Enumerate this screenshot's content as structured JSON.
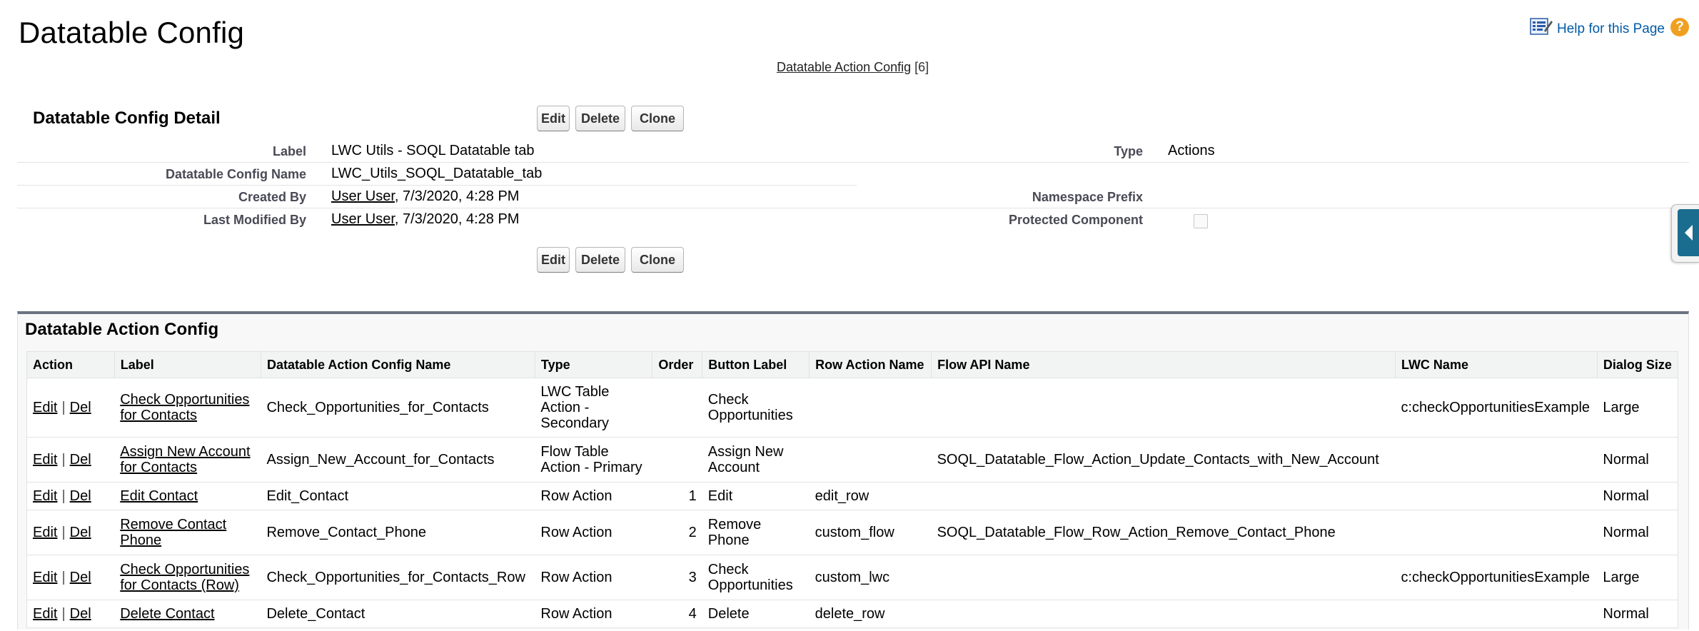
{
  "page": {
    "title": "Datatable Config",
    "help_link": "Help for this Page",
    "related_links": {
      "label": "Datatable Action Config",
      "count": "[6]"
    }
  },
  "detail": {
    "header": "Datatable Config Detail",
    "buttons": {
      "edit": "Edit",
      "delete": "Delete",
      "clone": "Clone"
    },
    "fields": {
      "label": {
        "label": "Label",
        "value": "LWC Utils - SOQL Datatable tab"
      },
      "config_name": {
        "label": "Datatable Config Name",
        "value": "LWC_Utils_SOQL_Datatable_tab"
      },
      "created_by": {
        "label": "Created By",
        "user": "User User",
        "date": ", 7/3/2020, 4:28 PM"
      },
      "last_modified_by": {
        "label": "Last Modified By",
        "user": "User User",
        "date": ", 7/3/2020, 4:28 PM"
      },
      "type": {
        "label": "Type",
        "value": "Actions"
      },
      "namespace_prefix": {
        "label": "Namespace Prefix",
        "value": ""
      },
      "protected_component": {
        "label": "Protected Component",
        "checked": false
      }
    }
  },
  "related_list": {
    "title": "Datatable Action Config",
    "columns": [
      "Action",
      "Label",
      "Datatable Action Config Name",
      "Type",
      "Order",
      "Button Label",
      "Row Action Name",
      "Flow API Name",
      "LWC Name",
      "Dialog Size"
    ],
    "action_edit": "Edit",
    "action_del": "Del",
    "action_sep": "|",
    "rows": [
      {
        "label": "Check Opportunities for Contacts",
        "name": "Check_Opportunities_for_Contacts",
        "type": "LWC Table Action - Secondary",
        "order": "",
        "button_label": "Check Opportunities",
        "row_action": "",
        "flow_api": "",
        "lwc": "c:checkOpportunitiesExample",
        "dialog": "Large"
      },
      {
        "label": "Assign New Account for Contacts",
        "name": "Assign_New_Account_for_Contacts",
        "type": "Flow Table Action - Primary",
        "order": "",
        "button_label": "Assign New Account",
        "row_action": "",
        "flow_api": "SOQL_Datatable_Flow_Action_Update_Contacts_with_New_Account",
        "lwc": "",
        "dialog": "Normal"
      },
      {
        "label": "Edit Contact",
        "name": "Edit_Contact",
        "type": "Row Action",
        "order": "1",
        "button_label": "Edit",
        "row_action": "edit_row",
        "flow_api": "",
        "lwc": "",
        "dialog": "Normal"
      },
      {
        "label": "Remove Contact Phone",
        "name": "Remove_Contact_Phone",
        "type": "Row Action",
        "order": "2",
        "button_label": "Remove Phone",
        "row_action": "custom_flow",
        "flow_api": "SOQL_Datatable_Flow_Row_Action_Remove_Contact_Phone",
        "lwc": "",
        "dialog": "Normal"
      },
      {
        "label": "Check Opportunities for Contacts (Row)",
        "name": "Check_Opportunities_for_Contacts_Row",
        "type": "Row Action",
        "order": "3",
        "button_label": "Check Opportunities",
        "row_action": "custom_lwc",
        "flow_api": "",
        "lwc": "c:checkOpportunitiesExample",
        "dialog": "Large"
      },
      {
        "label": "Delete Contact",
        "name": "Delete_Contact",
        "type": "Row Action",
        "order": "4",
        "button_label": "Delete",
        "row_action": "delete_row",
        "flow_api": "",
        "lwc": "",
        "dialog": "Normal"
      }
    ]
  },
  "icons": {
    "help_icon": "page-help-icon",
    "question_icon": "question-mark-icon",
    "sidebar_toggle": "collapse-arrow-icon"
  },
  "colors": {
    "link": "#015ba7",
    "help_orange": "#f0a020",
    "list_top_border": "#6b7381",
    "side_tab": "#1b6d8f"
  }
}
